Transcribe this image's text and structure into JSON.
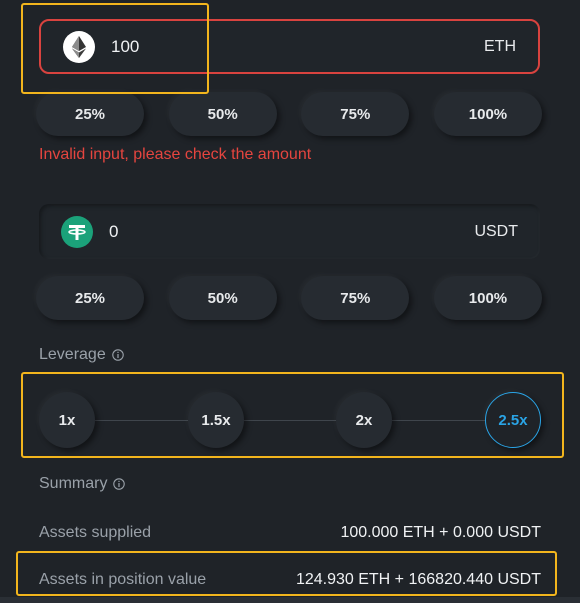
{
  "input_eth": {
    "value": "100",
    "unit": "ETH"
  },
  "percent_buttons_eth": [
    "25%",
    "50%",
    "75%",
    "100%"
  ],
  "error_message": "Invalid input, please check the amount",
  "input_usdt": {
    "value": "0",
    "unit": "USDT"
  },
  "percent_buttons_usdt": [
    "25%",
    "50%",
    "75%",
    "100%"
  ],
  "leverage": {
    "label": "Leverage",
    "options": [
      "1x",
      "1.5x",
      "2x",
      "2.5x"
    ],
    "selected": "2.5x"
  },
  "summary": {
    "label": "Summary",
    "rows": [
      {
        "label": "Assets supplied",
        "value": "100.000 ETH + 0.000 USDT"
      },
      {
        "label": "Assets in position value",
        "value": "124.930 ETH + 166820.440 USDT"
      }
    ]
  },
  "colors": {
    "background": "#1f2328",
    "error": "#e5453f",
    "accent": "#2aa4e6",
    "highlight": "#f2b51d",
    "usdt": "#1ba27a"
  },
  "icons": [
    "eth-icon",
    "usdt-icon",
    "info-icon"
  ]
}
